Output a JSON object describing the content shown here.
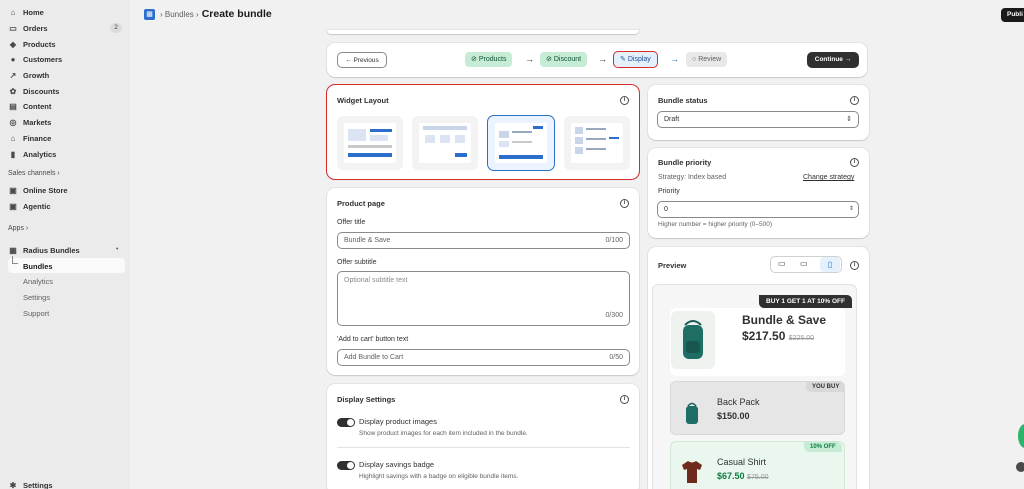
{
  "sidebar": {
    "items": [
      {
        "label": "Home",
        "icon": "home-icon"
      },
      {
        "label": "Orders",
        "icon": "inbox-icon",
        "badge": "2"
      },
      {
        "label": "Products",
        "icon": "tag-icon"
      },
      {
        "label": "Customers",
        "icon": "person-icon"
      },
      {
        "label": "Growth",
        "icon": "growth-icon"
      },
      {
        "label": "Discounts",
        "icon": "discount-icon"
      },
      {
        "label": "Content",
        "icon": "content-icon"
      },
      {
        "label": "Markets",
        "icon": "globe-icon"
      },
      {
        "label": "Finance",
        "icon": "bank-icon"
      },
      {
        "label": "Analytics",
        "icon": "chart-icon"
      }
    ],
    "sales_channels_label": "Sales channels",
    "channels": [
      {
        "label": "Online Store",
        "icon": "store-icon"
      },
      {
        "label": "Agentic",
        "icon": "agentic-icon"
      }
    ],
    "apps_label": "Apps",
    "app_name": "Radius Bundles",
    "app_sub": [
      "Bundles",
      "Analytics",
      "Settings",
      "Support"
    ],
    "settings_label": "Settings"
  },
  "header": {
    "breadcrumb": "Bundles",
    "title": "Create bundle",
    "publish_label": "Publi"
  },
  "steps": {
    "previous": "← Previous",
    "items": [
      "Products",
      "Discount",
      "Display",
      "Review"
    ],
    "continue": "Continue →"
  },
  "widget_layout": {
    "title": "Widget Layout",
    "selected_index": 2
  },
  "product_page": {
    "title": "Product page",
    "offer_title_label": "Offer title",
    "offer_title_value": "Bundle & Save",
    "offer_title_count": "0/100",
    "offer_subtitle_label": "Offer subtitle",
    "offer_subtitle_placeholder": "Optional subtitle text",
    "offer_subtitle_count": "0/300",
    "cart_label": "'Add to cart' button text",
    "cart_value": "Add Bundle to Cart",
    "cart_count": "0/50"
  },
  "display_settings": {
    "title": "Display Settings",
    "toggles": [
      {
        "label": "Display product images",
        "help": "Show product images for each item included in the bundle."
      },
      {
        "label": "Display savings badge",
        "help": "Highlight savings with a badge on eligible bundle items."
      }
    ]
  },
  "bundle_status": {
    "title": "Bundle status",
    "value": "Draft"
  },
  "bundle_priority": {
    "title": "Bundle priority",
    "strategy": "Strategy: Index based",
    "change_link": "Change strategy",
    "priority_label": "Priority",
    "priority_value": "0",
    "help": "Higher number = higher priority (0–500)"
  },
  "preview": {
    "title": "Preview",
    "offer_badge": "BUY 1 GET 1 AT 10% OFF",
    "bundle_title": "Bundle & Save",
    "bundle_price": "$217.50",
    "bundle_compare": "$225.00",
    "items": [
      {
        "tag": "YOU BUY",
        "name": "Back Pack",
        "price": "$150.00",
        "compare": ""
      },
      {
        "tag": "10% OFF",
        "name": "Casual Shirt",
        "price": "$67.50",
        "compare": "$75.00"
      }
    ]
  },
  "colors": {
    "accent": "#2c6ecb",
    "highlight_border": "#d82c2c",
    "success_bg": "#c7ecd5",
    "price_green": "#0a7c3e"
  }
}
